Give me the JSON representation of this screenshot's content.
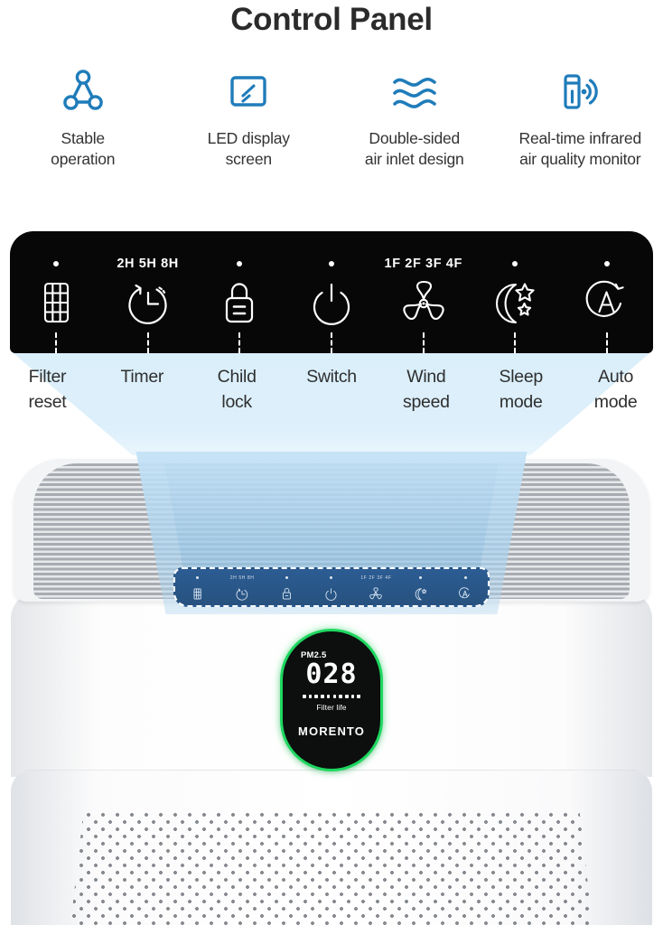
{
  "header": {
    "title": "Control Panel"
  },
  "accent_color": "#1f7cba",
  "features": [
    {
      "icon": "network-triangle-icon",
      "label": "Stable\noperation"
    },
    {
      "icon": "led-screen-icon",
      "label": "LED display\nscreen"
    },
    {
      "icon": "air-waves-icon",
      "label": "Double-sided\nair inlet design"
    },
    {
      "icon": "infrared-sensor-icon",
      "label": "Real-time infrared\nair quality monitor"
    }
  ],
  "control_panel": {
    "buttons": [
      {
        "icon": "filter-grid-icon",
        "indicator": "dot",
        "indicator_text": "",
        "label": "Filter\nreset"
      },
      {
        "icon": "timer-clock-icon",
        "indicator": "text",
        "indicator_text": "2H  5H  8H",
        "label": "Timer"
      },
      {
        "icon": "child-lock-icon",
        "indicator": "dot",
        "indicator_text": "",
        "label": "Child\nlock"
      },
      {
        "icon": "power-switch-icon",
        "indicator": "dot",
        "indicator_text": "",
        "label": "Switch"
      },
      {
        "icon": "fan-speed-icon",
        "indicator": "text",
        "indicator_text": "1F  2F  3F  4F",
        "label": "Wind\nspeed"
      },
      {
        "icon": "sleep-moon-icon",
        "indicator": "dot",
        "indicator_text": "",
        "label": "Sleep\nmode"
      },
      {
        "icon": "auto-mode-icon",
        "indicator": "dot",
        "indicator_text": "",
        "label": "Auto\nmode"
      }
    ]
  },
  "product": {
    "led_display": {
      "metric_label": "PM2.5",
      "value": "028",
      "filter_life_label": "Filter life",
      "filter_life_segments_total": 10,
      "filter_life_segments_on": 10,
      "brand": "MORENTO",
      "glow_color": "#1ed760"
    }
  }
}
